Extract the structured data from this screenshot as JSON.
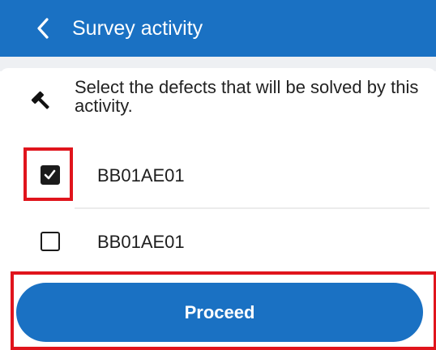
{
  "header": {
    "title": "Survey activity",
    "back_icon": "chevron-left-icon",
    "background_color": "#1a71c3"
  },
  "instruction": {
    "icon": "hammer-icon",
    "text": "Select the defects that will be solved by this activity."
  },
  "defects": [
    {
      "label": "BB01AE01",
      "checked": true
    },
    {
      "label": "BB01AE01",
      "checked": false
    }
  ],
  "proceed": {
    "label": "Proceed",
    "color": "#1a71c3"
  },
  "highlight_color": "#e0141c"
}
